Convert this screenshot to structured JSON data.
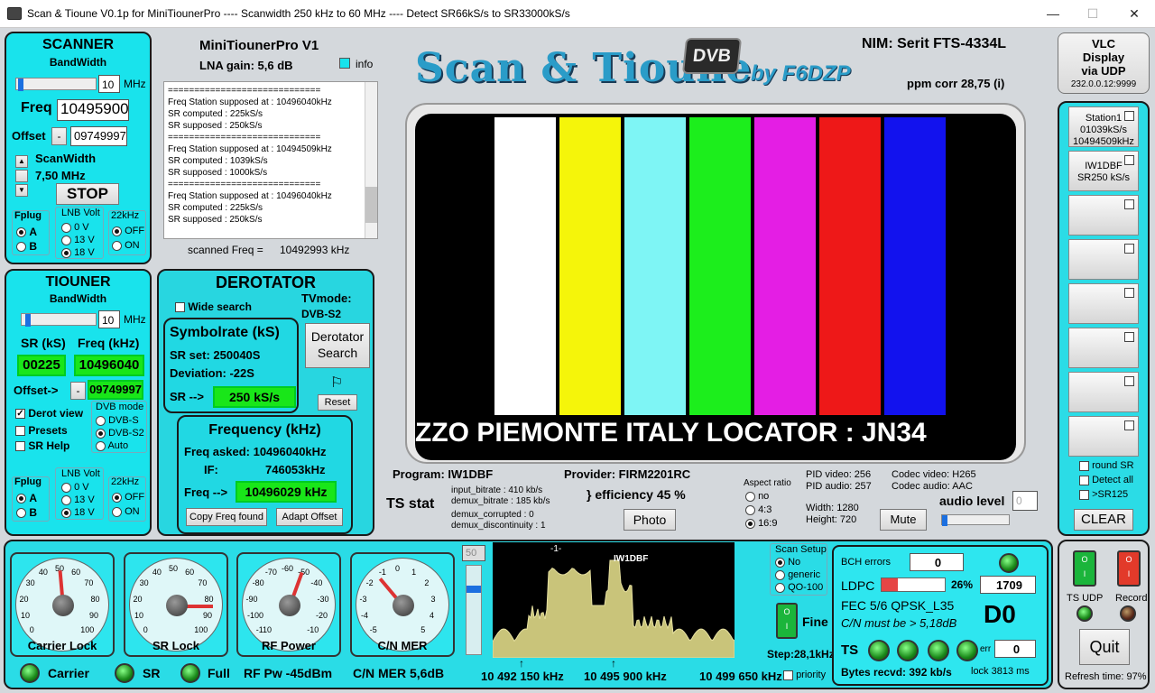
{
  "window": {
    "title": "Scan & Tioune V0.1p for MiniTiounerPro ---- Scanwidth 250 kHz to 60 MHz ---- Detect SR66kS/s to SR33000kS/s"
  },
  "scanner": {
    "title": "SCANNER",
    "bandwidth_label": "BandWidth",
    "bandwidth_value": "10",
    "bandwidth_unit": "MHz",
    "freq_label": "Freq",
    "freq_value": "10495900",
    "offset_label": "Offset",
    "offset_sign": "-",
    "offset_value": "09749997",
    "scanwidth_label": "ScanWidth",
    "scanwidth_value": "7,50 MHz",
    "stop_label": "STOP",
    "fplug_label": "Fplug",
    "fplug_a": "A",
    "fplug_b": "B",
    "lnb_label": "LNB Volt",
    "lnb_0": "0 V",
    "lnb_13": "13 V",
    "lnb_18": "18 V",
    "khz_label": "22kHz",
    "off": "OFF",
    "on": "ON"
  },
  "tiouner": {
    "title": "TIOUNER",
    "bandwidth_label": "BandWidth",
    "bandwidth_value": "10",
    "bandwidth_unit": "MHz",
    "sr_label": "SR (kS)",
    "freq_label": "Freq (kHz)",
    "sr_value": "00225",
    "freq_value": "10496040",
    "offset_label": "Offset->",
    "offset_sign": "-",
    "offset_value": "09749997",
    "derot_view": "Derot view",
    "presets": "Presets",
    "sr_help": "SR Help",
    "dvb_label": "DVB mode",
    "dvb_s": "DVB-S",
    "dvb_s2": "DVB-S2",
    "dvb_auto": "Auto",
    "fplug_label": "Fplug",
    "fplug_a": "A",
    "fplug_b": "B",
    "lnb_label": "LNB Volt",
    "lnb_0": "0 V",
    "lnb_13": "13 V",
    "lnb_18": "18 V",
    "khz_label": "22kHz",
    "off": "OFF",
    "on": "ON"
  },
  "info": {
    "device": "MiniTiounerPro V1",
    "lna": "LNA gain: 5,6 dB",
    "info_label": "info",
    "log": [
      "=============================",
      "Freq Station supposed at : 10496040kHz",
      "SR computed : 225kS/s",
      "SR supposed : 250kS/s",
      "=============================",
      "Freq Station supposed at : 10494509kHz",
      "SR computed : 1039kS/s",
      "SR supposed : 1000kS/s",
      "=============================",
      "Freq Station supposed at : 10496040kHz",
      "SR computed : 225kS/s",
      "SR supposed : 250kS/s"
    ],
    "scanned_label": "scanned Freq =",
    "scanned_value": "10492993 kHz"
  },
  "derotator": {
    "title": "DEROTATOR",
    "wide_search": "Wide search",
    "tvmode_label": "TVmode:",
    "tvmode_value": "DVB-S2",
    "sr_box_title": "Symbolrate (kS)",
    "sr_set": "SR set:  250040S",
    "deviation": "Deviation:  -22S",
    "sr_arrow": "SR -->",
    "sr_value": "250 kS/s",
    "derot_search": "Derotator Search",
    "reset": "Reset",
    "freq_box_title": "Frequency (kHz)",
    "freq_asked": "Freq asked:  10496040kHz",
    "if_label": "IF:",
    "if_value": "746053kHz",
    "freq_arrow": "Freq -->",
    "freq_value": "10496029 kHz",
    "copy_freq": "Copy Freq found",
    "adapt_offset": "Adapt Offset"
  },
  "header": {
    "logo_text": "Scan & Tioune",
    "logo_badge": "DVB",
    "logo_by": "by F6DZP",
    "nim": "NIM:  Serit FTS-4334L",
    "ppm": "ppm corr   28,75 (i)"
  },
  "video": {
    "ticker": "ZZO PIEMONTE ITALY  LOCATOR : JN34",
    "bars": [
      "#ffffff",
      "#f5f50a",
      "#7ef5f5",
      "#1cee1c",
      "#e41ee4",
      "#ee1818",
      "#1212ee",
      "#000000"
    ]
  },
  "stream": {
    "program": "Program: IW1DBF",
    "provider": "Provider: FIRM2201RC",
    "ts_stat": "TS stat",
    "input_bitrate": "input_bitrate :  410 kb/s",
    "demux_bitrate": "demux_bitrate :  185 kb/s",
    "demux_corrupted": "demux_corrupted :  0",
    "demux_discontinuity": "demux_discontinuity :  1",
    "efficiency": "} efficiency  45 %",
    "photo": "Photo",
    "aspect_label": "Aspect ratio",
    "aspect_no": "no",
    "aspect_43": "4:3",
    "aspect_169": "16:9",
    "pid_video": "PID video:  256",
    "pid_audio": "PID audio:  257",
    "codec_video": "Codec video:  H265",
    "codec_audio": "Codec audio:  AAC",
    "width": "Width:      1280",
    "height": "Height:    720",
    "mute": "Mute",
    "audio_level_label": "audio level",
    "audio_level_value": "0"
  },
  "vlc": {
    "line1": "VLC",
    "line2": "Display",
    "line3": "via UDP",
    "addr": "232.0.0.12:9999"
  },
  "stations": {
    "s1_name": "Station1",
    "s1_sr": "01039kS/s",
    "s1_freq": "10494509kHz",
    "s2_name": "IW1DBF",
    "s2_sr": "SR250 kS/s",
    "round_sr": "round SR",
    "detect_all": "Detect all",
    "sr125": ">SR125",
    "clear": "CLEAR"
  },
  "gauges": [
    {
      "label": "Carrier Lock",
      "ticks": [
        "0",
        "10",
        "20",
        "30",
        "40",
        "50",
        "60",
        "70",
        "80",
        "90",
        "100"
      ]
    },
    {
      "label": "SR Lock",
      "ticks": [
        "0",
        "10",
        "20",
        "30",
        "40",
        "50",
        "60",
        "70",
        "80",
        "90",
        "100"
      ]
    },
    {
      "label": "RF Power",
      "ticks": [
        "-110",
        "-100",
        "-90",
        "-80",
        "-70",
        "-60",
        "-50",
        "-40",
        "-30",
        "-20",
        "-10"
      ]
    },
    {
      "label": "C/N MER",
      "ticks": [
        "-5",
        "-4",
        "-3",
        "-2",
        "-1",
        "0",
        "1",
        "2",
        "3",
        "4",
        "5"
      ]
    }
  ],
  "status": {
    "carrier": "Carrier",
    "sr": "SR",
    "full": "Full",
    "rf_pw": "RF Pw  -45dBm",
    "cn_mer": "C/N MER 5,6dB"
  },
  "spectrum": {
    "level": "50",
    "marker": "-1-",
    "station": "IW1DBF",
    "f_left": "10 492 150 kHz",
    "f_mid": "10 495 900 kHz",
    "f_right": "10 499 650 kHz",
    "priority": "priority",
    "scan_setup": "Scan Setup",
    "opt_no": "No",
    "opt_generic": "generic",
    "opt_qo": "QO-100",
    "fine": "Fine",
    "step": "Step:28,1kHz"
  },
  "decoder": {
    "bch_label": "BCH errors",
    "bch_value": "0",
    "ldpc_label": "LDPC",
    "ldpc_pct": "26%",
    "ldpc_value": "1709",
    "ldpc_fill": 0.26,
    "fec": "FEC  5/6 QPSK_L35",
    "cn_must": "C/N must be > 5,18dB",
    "d0": "D0",
    "ts_label": "TS",
    "err_label": "err",
    "err_value": "0",
    "bytes": "Bytes recvd: 392 kb/s",
    "lock": "lock  3813 ms"
  },
  "controls": {
    "ts_udp": "TS UDP",
    "record": "Record",
    "quit": "Quit",
    "refresh": "Refresh time:  97%"
  }
}
